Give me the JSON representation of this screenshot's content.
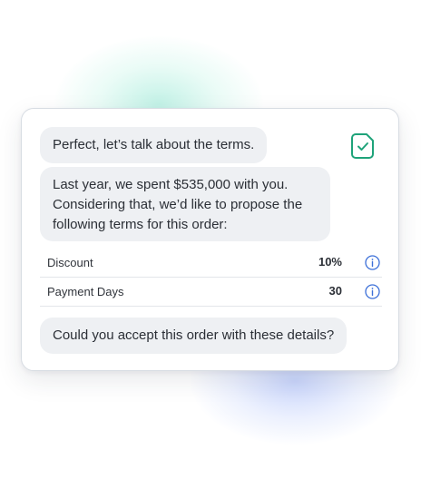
{
  "chat": {
    "message_1": "Perfect, let’s talk about the terms.",
    "message_2_lines": [
      "Last year, we spent $535,000 with you.",
      "Considering that, we’d like to propose the",
      "following terms for this order:"
    ],
    "message_3": "Could you accept this order with these details?"
  },
  "terms": {
    "rows": [
      {
        "label": "Discount",
        "value": "10%",
        "icon": "info-icon"
      },
      {
        "label": "Payment Days",
        "value": "30",
        "icon": "info-icon"
      }
    ]
  },
  "icons": {
    "document": "document-check-icon",
    "info": "info-icon"
  },
  "colors": {
    "accent_green": "#1fa37a",
    "info_blue": "#3b6fd8",
    "bubble_bg": "#eef0f3",
    "text": "#2b2f36"
  }
}
